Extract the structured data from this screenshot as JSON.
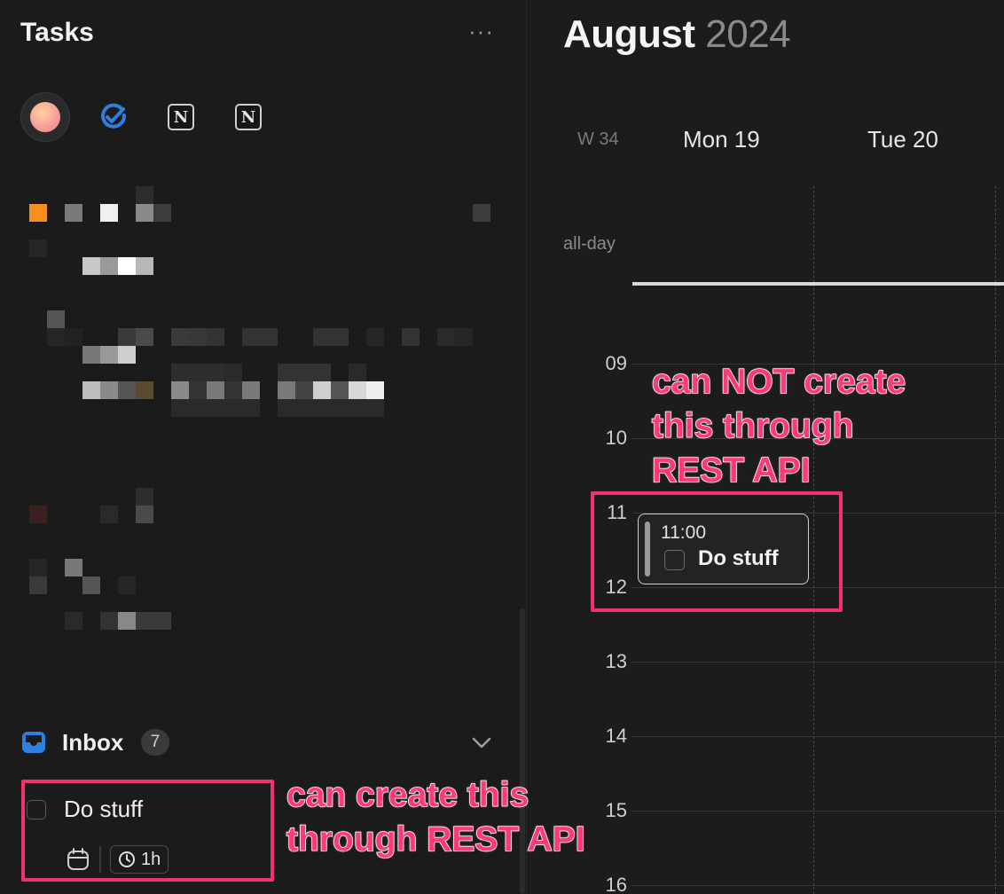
{
  "sidebar": {
    "title": "Tasks",
    "more_label": "···",
    "sources": [
      {
        "name": "avatar"
      },
      {
        "name": "check-circle"
      },
      {
        "name": "notion",
        "glyph": "N"
      },
      {
        "name": "notion",
        "glyph": "N"
      }
    ],
    "inbox": {
      "label": "Inbox",
      "count": "7"
    },
    "task": {
      "title": "Do stuff",
      "duration": "1h"
    }
  },
  "calendar": {
    "month": "August",
    "year": "2024",
    "week": "W 34",
    "days": [
      "Mon 19",
      "Tue 20"
    ],
    "allday_label": "all-day",
    "hours": [
      "09",
      "10",
      "11",
      "12",
      "13",
      "14",
      "15",
      "16"
    ],
    "event": {
      "time": "11:00",
      "title": "Do stuff"
    }
  },
  "annotations": {
    "left": "can create this\nthrough REST API",
    "right": "can NOT create\nthis through\nREST API",
    "color": "#f0346b"
  },
  "colors": {
    "accent_blue": "#2f7fe0",
    "pixel_orange": "#f5901e"
  }
}
